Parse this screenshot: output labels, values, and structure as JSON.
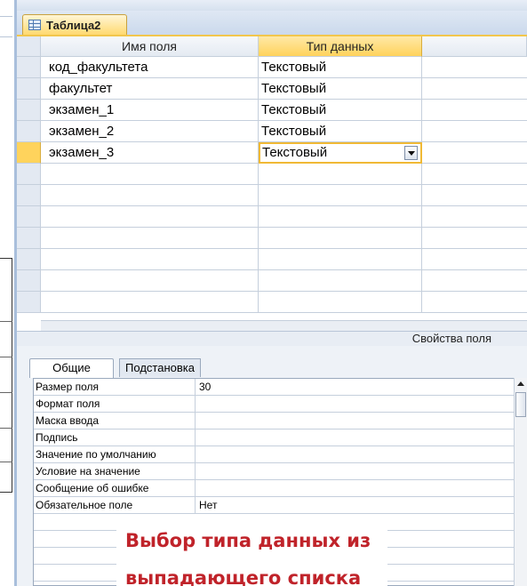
{
  "window": {
    "tab_title": "Таблица2"
  },
  "grid": {
    "columns": [
      "Имя поля",
      "Тип данных"
    ],
    "rows": [
      {
        "name": "код_факультета",
        "type": "Текстовый"
      },
      {
        "name": "факультет",
        "type": "Текстовый"
      },
      {
        "name": "экзамен_1",
        "type": "Текстовый"
      },
      {
        "name": "экзамен_2",
        "type": "Текстовый"
      },
      {
        "name": "экзамен_3",
        "type": "Текстовый"
      }
    ],
    "active_row_index": 4
  },
  "properties": {
    "section_title": "Свойства поля",
    "tabs": [
      "Общие",
      "Подстановка"
    ],
    "active_tab": "Общие",
    "rows": [
      {
        "label": "Размер поля",
        "value": "30"
      },
      {
        "label": "Формат поля",
        "value": ""
      },
      {
        "label": "Маска ввода",
        "value": ""
      },
      {
        "label": "Подпись",
        "value": ""
      },
      {
        "label": "Значение по умолчанию",
        "value": ""
      },
      {
        "label": "Условие на значение",
        "value": ""
      },
      {
        "label": "Сообщение об ошибке",
        "value": ""
      },
      {
        "label": "Обязательное поле",
        "value": "Нет"
      }
    ]
  },
  "caption": {
    "line1": "Выбор типа данных из",
    "line2": "выпадающего списка"
  },
  "colors": {
    "accent_yellow": "#ffd35c",
    "active_border": "#f0b935",
    "caption_red": "#c0232a",
    "frame_blue": "#a9bfdc"
  },
  "icons": {
    "tab": "table-icon",
    "dropdown": "dropdown-arrow-icon"
  }
}
